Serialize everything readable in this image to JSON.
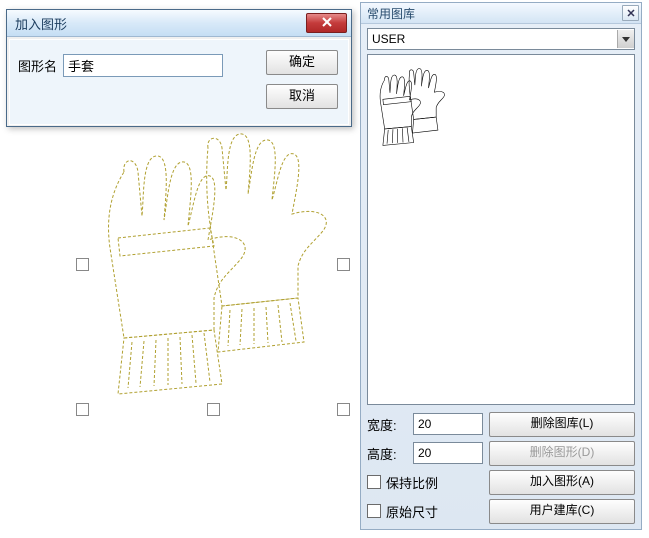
{
  "dialog": {
    "title": "加入图形",
    "shape_name_label": "图形名",
    "shape_name_value": "手套",
    "ok_label": "确定",
    "cancel_label": "取消"
  },
  "library": {
    "title": "常用图库",
    "selected_library": "USER",
    "width_label": "宽度:",
    "width_value": "20",
    "height_label": "高度:",
    "height_value": "20",
    "keep_ratio_label": "保持比例",
    "original_size_label": "原始尺寸",
    "delete_library_label": "删除图库(L)",
    "delete_shape_label": "删除图形(D)",
    "add_shape_label": "加入图形(A)",
    "create_library_label": "用户建库(C)"
  },
  "preview": {
    "item_name": "手套"
  }
}
